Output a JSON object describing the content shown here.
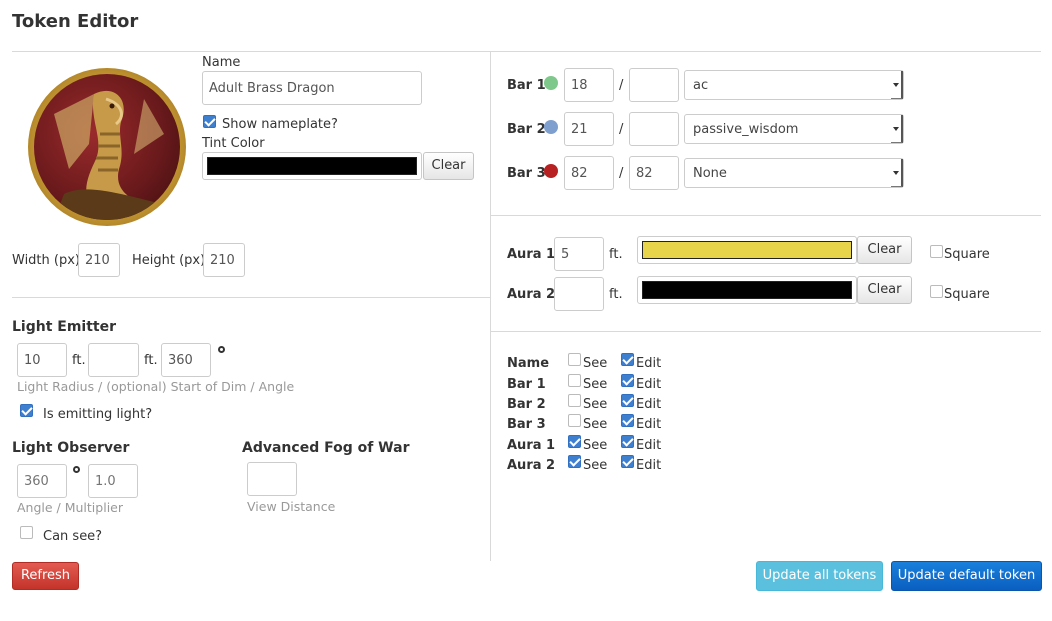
{
  "page": {
    "title": "Token Editor"
  },
  "token": {
    "name_label": "Name",
    "name_value": "Adult Brass Dragon",
    "show_nameplate_label": "Show nameplate?",
    "show_nameplate_checked": true,
    "tint_color_label": "Tint Color",
    "tint_color": "#000000",
    "clear_label": "Clear",
    "width_label": "Width (px)",
    "width_value": "210",
    "height_label": "Height (px)",
    "height_value": "210"
  },
  "light": {
    "emitter_heading": "Light Emitter",
    "radius": "10",
    "dim_start": "",
    "angle": "360",
    "unit": "ft.",
    "hint": "Light Radius / (optional) Start of Dim / Angle",
    "emitting_label": "Is emitting light?",
    "emitting_checked": true,
    "observer_heading": "Light Observer",
    "observer_angle_placeholder": "360",
    "observer_multiplier_placeholder": "1.0",
    "observer_hint": "Angle / Multiplier",
    "can_see_label": "Can see?",
    "can_see_checked": false,
    "fog_heading": "Advanced Fog of War",
    "view_distance": "",
    "view_distance_hint": "View Distance"
  },
  "bars": [
    {
      "label": "Bar 1",
      "color": "#7ec88b",
      "value": "18",
      "max": "",
      "link": "ac"
    },
    {
      "label": "Bar 2",
      "color": "#7f9fcf",
      "value": "21",
      "max": "",
      "link": "passive_wisdom"
    },
    {
      "label": "Bar 3",
      "color": "#b72121",
      "value": "82",
      "max": "82",
      "link": "None"
    }
  ],
  "bar_separator": "/",
  "auras": [
    {
      "label": "Aura 1",
      "radius": "5",
      "unit": "ft.",
      "color": "#e8d44a",
      "clear_label": "Clear",
      "square_label": "Square",
      "square_checked": false
    },
    {
      "label": "Aura 2",
      "radius": "",
      "unit": "ft.",
      "color": "#000000",
      "clear_label": "Clear",
      "square_label": "Square",
      "square_checked": false
    }
  ],
  "permissions": {
    "see_label": "See",
    "edit_label": "Edit",
    "rows": [
      {
        "label": "Name",
        "see": false,
        "edit": true
      },
      {
        "label": "Bar 1",
        "see": false,
        "edit": true
      },
      {
        "label": "Bar 2",
        "see": false,
        "edit": true
      },
      {
        "label": "Bar 3",
        "see": false,
        "edit": true
      },
      {
        "label": "Aura 1",
        "see": true,
        "edit": true
      },
      {
        "label": "Aura 2",
        "see": true,
        "edit": true
      }
    ]
  },
  "footer": {
    "refresh_label": "Refresh",
    "update_all_label": "Update all tokens",
    "update_default_label": "Update default token"
  }
}
